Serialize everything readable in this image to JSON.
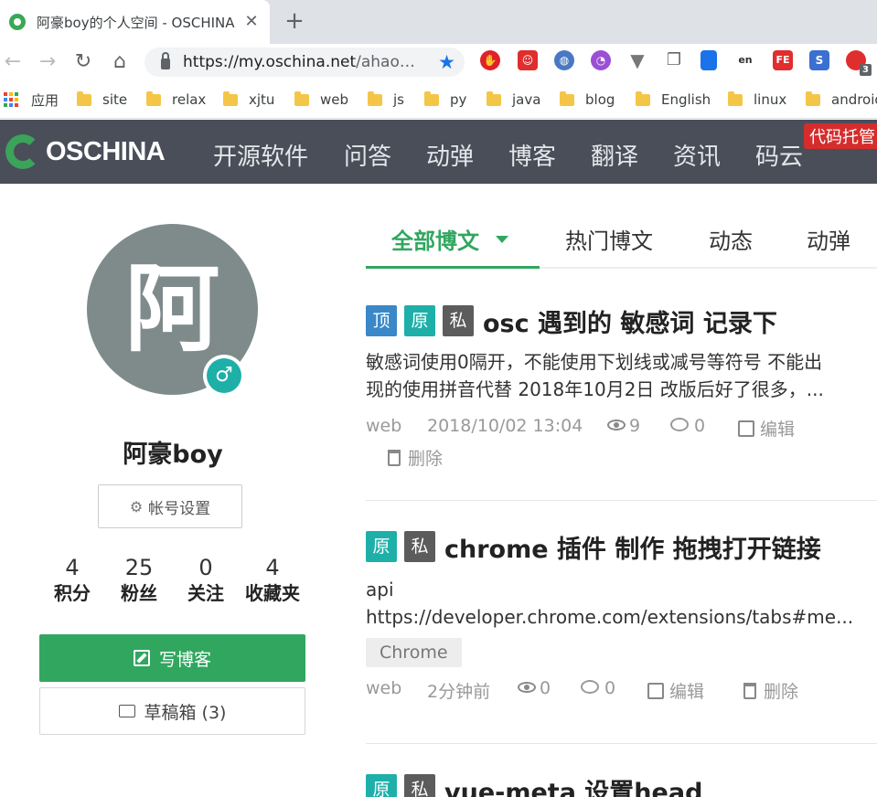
{
  "browser": {
    "tab_title": "阿豪boy的个人空间 - OSCHINA",
    "tab_close": "✕",
    "new_tab": "+",
    "url_host": "https://my.oschina.net",
    "url_rest": "/ahao…",
    "ext_badge": "3",
    "bookmarks": [
      {
        "label": "应用",
        "icon": "apps-icon"
      },
      {
        "label": "site",
        "icon": "folder-icon"
      },
      {
        "label": "relax",
        "icon": "folder-icon"
      },
      {
        "label": "xjtu",
        "icon": "folder-icon"
      },
      {
        "label": "web",
        "icon": "folder-icon"
      },
      {
        "label": "js",
        "icon": "folder-icon"
      },
      {
        "label": "py",
        "icon": "folder-icon"
      },
      {
        "label": "java",
        "icon": "folder-icon"
      },
      {
        "label": "blog",
        "icon": "folder-icon"
      },
      {
        "label": "English",
        "icon": "folder-icon"
      },
      {
        "label": "linux",
        "icon": "folder-icon"
      },
      {
        "label": "android",
        "icon": "folder-icon"
      }
    ]
  },
  "site": {
    "logo_text": "OSCHINA",
    "nav": [
      "开源软件",
      "问答",
      "动弹",
      "博客",
      "翻译",
      "资讯",
      "码云"
    ],
    "repo_badge": "代码托管"
  },
  "profile": {
    "avatar_char": "阿",
    "gender_symbol": "♂",
    "name": "阿豪boy",
    "settings_label": "帐号设置",
    "stats": [
      {
        "value": "4",
        "label": "积分"
      },
      {
        "value": "25",
        "label": "粉丝"
      },
      {
        "value": "0",
        "label": "关注"
      },
      {
        "value": "4",
        "label": "收藏夹"
      }
    ],
    "write_label": "写博客",
    "draft_label": "草稿箱 (3)"
  },
  "tabs": [
    "全部博文",
    "热门博文",
    "动态",
    "动弹"
  ],
  "posts": [
    {
      "tags": [
        "顶",
        "原",
        "私"
      ],
      "title": "osc 遇到的 敏感词 记录下",
      "excerpt": [
        "敏感词使用0隔开，不能使用下划线或减号等符号 不能出",
        "现的使用拼音代替 2018年10月2日 改版后好了很多，..."
      ],
      "category": "web",
      "time": "2018/10/02 13:04",
      "views": "9",
      "comments": "0",
      "edit": "编辑",
      "delete": "删除"
    },
    {
      "tags": [
        "原",
        "私"
      ],
      "title": "chrome 插件 制作 拖拽打开链接",
      "excerpt": [
        "api",
        "https://developer.chrome.com/extensions/tabs#me..."
      ],
      "chip": "Chrome",
      "category": "web",
      "time": "2分钟前",
      "views": "0",
      "comments": "0",
      "edit": "编辑",
      "delete": "删除"
    },
    {
      "tags": [
        "原",
        "私"
      ],
      "title": "vue-meta 设置head"
    }
  ]
}
